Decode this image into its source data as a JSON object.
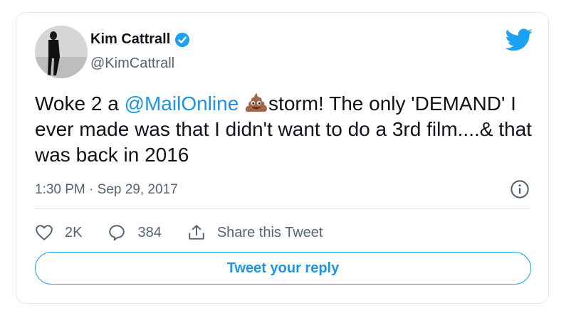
{
  "user": {
    "display_name": "Kim Cattrall",
    "handle": "@KimCattrall",
    "verified": true
  },
  "tweet": {
    "text_before_mention": "Woke 2 a ",
    "mention": "@MailOnline",
    "emoji": "pile-of-poo-emoji",
    "text_after_emoji": "storm! The only 'DEMAND' I ever made was that I didn't want to do a 3rd film....& that was back in 2016",
    "timestamp": "1:30 PM · Sep 29, 2017"
  },
  "actions": {
    "likes": "2K",
    "replies": "384",
    "share_label": "Share this Tweet"
  },
  "reply_button_label": "Tweet your reply",
  "colors": {
    "accent": "#1da1f2",
    "link": "#1b95e0",
    "text_primary": "#0f1419",
    "text_secondary": "#536471",
    "border": "#e1e8ed"
  },
  "icons": {
    "brand": "twitter-bird-icon",
    "verified": "verified-badge-icon",
    "info": "info-icon",
    "like": "heart-icon",
    "reply": "reply-bubble-icon",
    "share": "share-icon"
  }
}
